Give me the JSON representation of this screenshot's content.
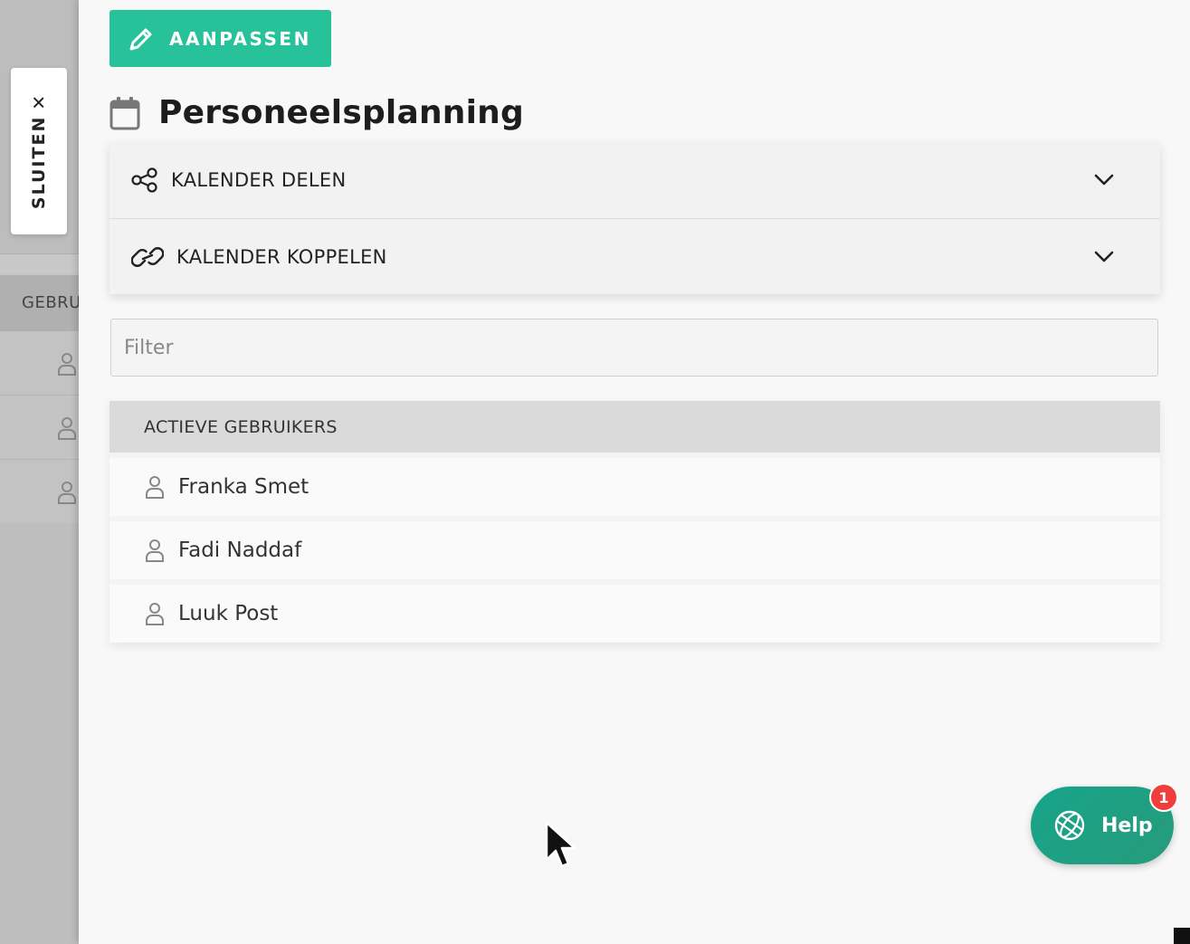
{
  "background": {
    "header_fragment": "GEBRU"
  },
  "close_tab": {
    "label": "SLUITEN",
    "icon": "close-icon"
  },
  "panel": {
    "edit_button": {
      "label": "AANPASSEN",
      "icon": "pencil-icon"
    },
    "title": "Personeelsplanning",
    "title_icon": "calendar-icon",
    "accordion": [
      {
        "label": "KALENDER DELEN",
        "icon": "share-icon"
      },
      {
        "label": "KALENDER KOPPELEN",
        "icon": "link-icon"
      }
    ],
    "filter": {
      "placeholder": "Filter",
      "value": ""
    },
    "users": {
      "header": "ACTIEVE GEBRUIKERS",
      "items": [
        {
          "name": "Franka Smet"
        },
        {
          "name": "Fadi Naddaf"
        },
        {
          "name": "Luuk Post"
        }
      ]
    }
  },
  "help": {
    "label": "Help",
    "badge": "1",
    "icon": "globe-icon"
  },
  "colors": {
    "accent": "#27c29a",
    "help": "#17a58a",
    "badge": "#ef3e3e"
  }
}
